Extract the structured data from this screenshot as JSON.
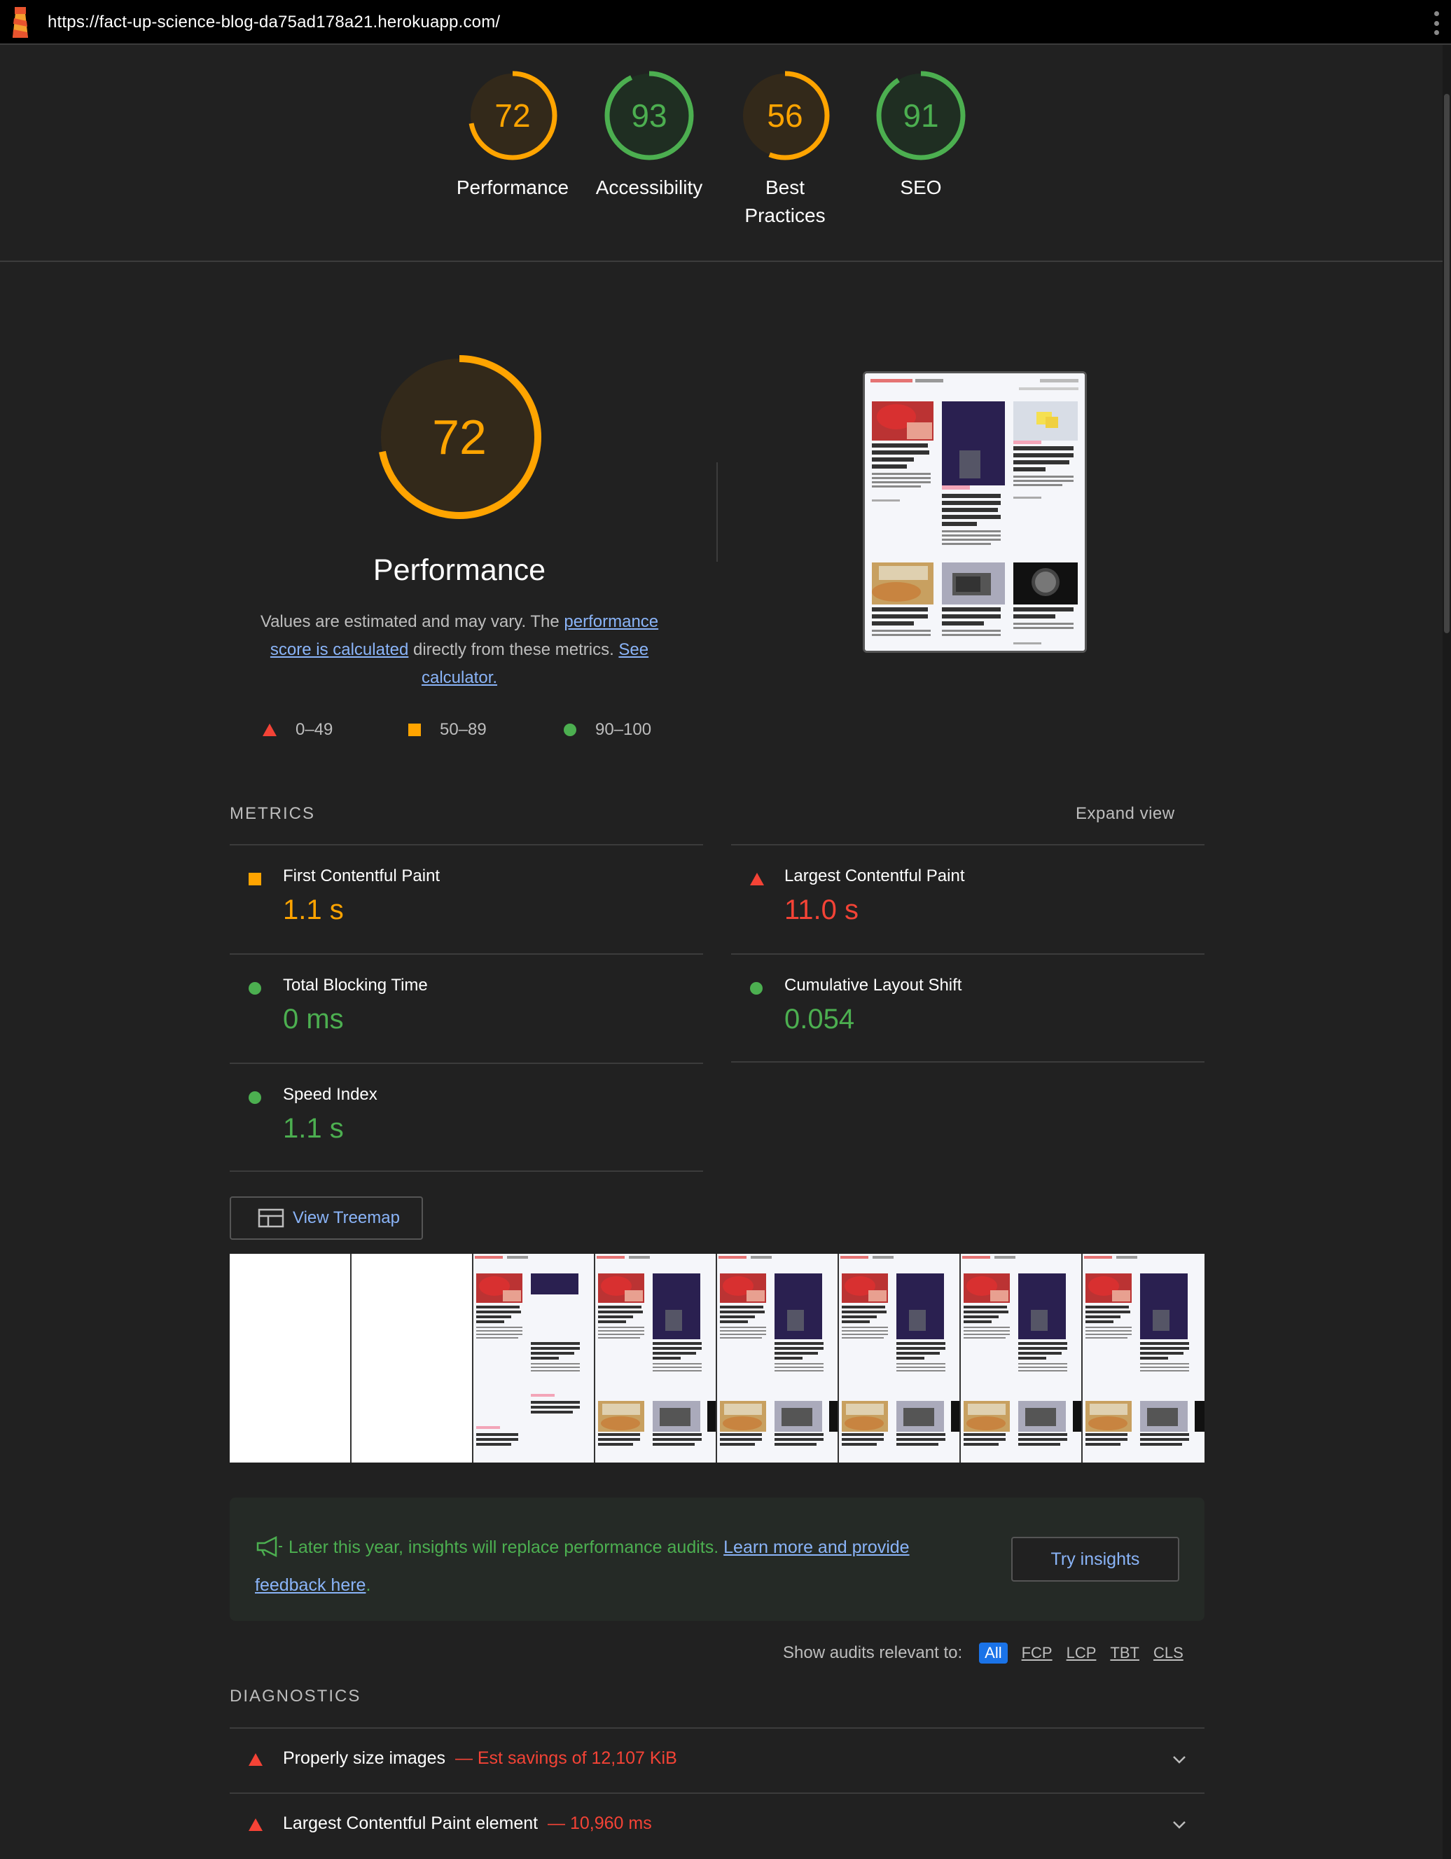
{
  "url": "https://fact-up-science-blog-da75ad178a21.herokuapp.com/",
  "colors": {
    "pass": "#4caf50",
    "average": "#ffa400",
    "fail": "#f44336",
    "link": "#8ab4f8"
  },
  "gauges": [
    {
      "score": "72",
      "label": "Performance",
      "status": "average",
      "value": 0.72
    },
    {
      "score": "93",
      "label": "Accessibility",
      "status": "pass",
      "value": 0.93
    },
    {
      "score": "56",
      "label": "Best Practices",
      "status": "average",
      "value": 0.56
    },
    {
      "score": "91",
      "label": "SEO",
      "status": "pass",
      "value": 0.91
    }
  ],
  "performance": {
    "score": "72",
    "title": "Performance",
    "desc_pre": "Values are estimated and may vary. The ",
    "desc_link1": "performance score is calculated",
    "desc_mid": " directly from these metrics. ",
    "desc_link2": "See calculator.",
    "legend": {
      "fail": "0–49",
      "average": "50–89",
      "pass": "90–100"
    }
  },
  "metrics_section": {
    "title": "METRICS",
    "expand": "Expand view"
  },
  "metrics": [
    {
      "label": "First Contentful Paint",
      "value": "1.1 s",
      "status": "average"
    },
    {
      "label": "Largest Contentful Paint",
      "value": "11.0 s",
      "status": "fail"
    },
    {
      "label": "Total Blocking Time",
      "value": "0 ms",
      "status": "pass"
    },
    {
      "label": "Cumulative Layout Shift",
      "value": "0.054",
      "status": "pass"
    },
    {
      "label": "Speed Index",
      "value": "1.1 s",
      "status": "pass"
    }
  ],
  "treemap_label": "View Treemap",
  "banner": {
    "text": "Later this year, insights will replace performance audits. ",
    "link": "Learn more and provide feedback here",
    "end": ".",
    "button": "Try insights"
  },
  "filter": {
    "label": "Show audits relevant to:",
    "chips": [
      "All",
      "FCP",
      "LCP",
      "TBT",
      "CLS"
    ]
  },
  "diagnostics_title": "DIAGNOSTICS",
  "diagnostics": [
    {
      "title": "Properly size images",
      "savings": "— Est savings of 12,107 KiB"
    },
    {
      "title": "Largest Contentful Paint element",
      "savings": "— 10,960 ms"
    }
  ]
}
